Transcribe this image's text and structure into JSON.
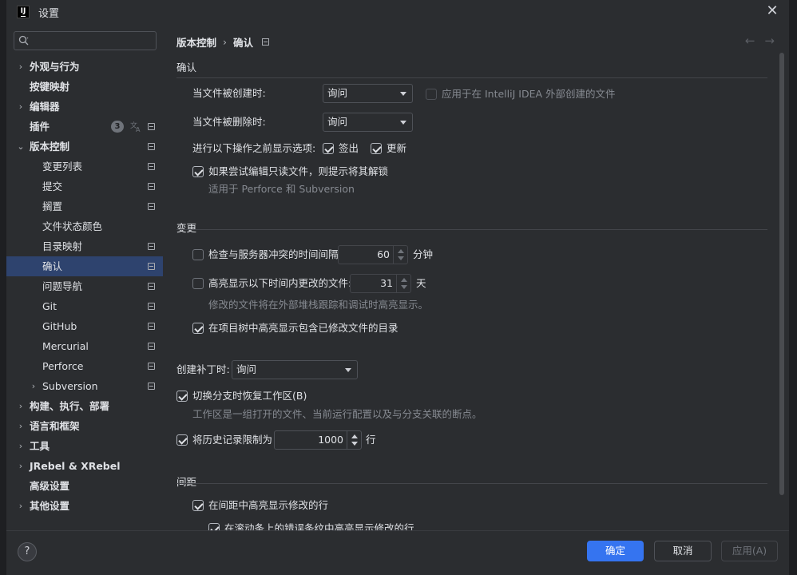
{
  "window": {
    "title": "设置",
    "logo_text": "IJ"
  },
  "search": {
    "placeholder": "",
    "value": ""
  },
  "sidebar": {
    "items": [
      {
        "label": "外观与行为",
        "arrow": "›"
      },
      {
        "label": "按键映射"
      },
      {
        "label": "编辑器",
        "arrow": "›"
      },
      {
        "label": "插件",
        "badge": "3"
      },
      {
        "label": "版本控制",
        "arrow": "⌄"
      },
      {
        "label": "变更列表"
      },
      {
        "label": "提交"
      },
      {
        "label": "搁置"
      },
      {
        "label": "文件状态颜色"
      },
      {
        "label": "目录映射"
      },
      {
        "label": "确认"
      },
      {
        "label": "问题导航"
      },
      {
        "label": "Git"
      },
      {
        "label": "GitHub"
      },
      {
        "label": "Mercurial"
      },
      {
        "label": "Perforce"
      },
      {
        "label": "Subversion",
        "arrow": "›"
      },
      {
        "label": "构建、执行、部署",
        "arrow": "›"
      },
      {
        "label": "语言和框架",
        "arrow": "›"
      },
      {
        "label": "工具",
        "arrow": "›"
      },
      {
        "label": "JRebel & XRebel",
        "arrow": "›"
      },
      {
        "label": "高级设置"
      },
      {
        "label": "其他设置",
        "arrow": "›"
      }
    ]
  },
  "breadcrumb": {
    "parent": "版本控制",
    "separator": "›",
    "current": "确认"
  },
  "nav": {
    "back": "←",
    "forward": "→"
  },
  "confirm": {
    "section": "确认",
    "on_create_label": "当文件被创建时:",
    "on_create_value": "询问",
    "external_label": "应用于在 IntelliJ IDEA 外部创建的文件",
    "on_delete_label": "当文件被删除时:",
    "on_delete_value": "询问",
    "before_ops_label": "进行以下操作之前显示选项:",
    "checkout_label": "签出",
    "update_label": "更新",
    "readonly_label": "如果尝试编辑只读文件，则提示将其解锁",
    "readonly_hint": "适用于 Perforce 和 Subversion"
  },
  "changes": {
    "section": "变更",
    "conflict_label": "检查与服务器冲突的时间间隔",
    "conflict_value": "60",
    "conflict_unit": "分钟",
    "highlight_label": "高亮显示以下时间内更改的文件:",
    "highlight_value": "31",
    "highlight_unit": "天",
    "highlight_hint": "修改的文件将在外部堆栈跟踪和调试时高亮显示。",
    "tree_label": "在项目树中高亮显示包含已修改文件的目录"
  },
  "patch": {
    "label": "创建补丁时:",
    "value": "询问",
    "restore_label": "切换分支时恢复工作区(B)",
    "restore_hint": "工作区是一组打开的文件、当前运行配置以及与分支关联的断点。",
    "history_label": "将历史记录限制为",
    "history_value": "1000",
    "history_unit": "行"
  },
  "gutter": {
    "section": "间距",
    "highlight_label": "在间距中高亮显示修改的行",
    "scrollbar_label": "在滚动条上的错误条纹中高亮显示修改的行"
  },
  "footer": {
    "help": "?",
    "ok": "确定",
    "cancel": "取消",
    "apply": "应用(A)"
  },
  "colors": {
    "background": "#2b2d30",
    "selection": "#2e436e",
    "primary_button": "#3574f0",
    "text": "#dfe1e5",
    "hint": "#868a91"
  }
}
